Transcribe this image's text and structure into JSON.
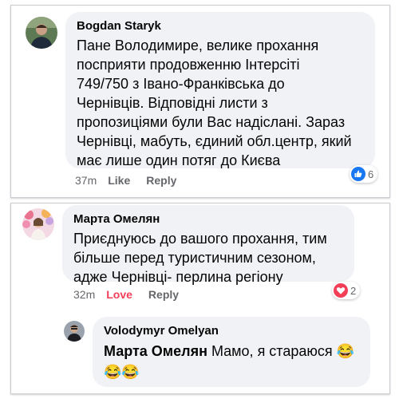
{
  "comments": [
    {
      "author": "Bogdan Staryk",
      "lines": [
        "Пане Володимире, велике прохання",
        "посприяти продовженню Інтерсіті",
        "749/750 з Івано-Франківська до",
        "Чернівців. Відповідні листи з",
        "пропозиціями були Вас надіслані. Зараз",
        "Чернівці, мабуть, єдиний обл.центр, який",
        "має лише один потяг до Києва"
      ],
      "time": "37m",
      "like_label": "Like",
      "reply_label": "Reply",
      "reaction": {
        "icon": "like-reaction-icon",
        "count": "6"
      }
    },
    {
      "author": "Марта Омелян",
      "lines": [
        "Приєднуюсь до вашого прохання, тим",
        "більше перед туристичним сезоном,",
        "адже  Чернівці- перлина регіону"
      ],
      "time": "32m",
      "like_label": "Love",
      "reply_label": "Reply",
      "reaction": {
        "icon": "love-reaction-icon",
        "count": "2"
      }
    },
    {
      "author": "Volodymyr Omelyan",
      "mention": "Марта Омелян",
      "text": "Мамо, я стараюся",
      "emoji_inline": "😂",
      "emoji_line2": "😂😂"
    }
  ],
  "colors": {
    "bubble": "#f0f2f5",
    "meta": "#65676b",
    "love": "#f33e58",
    "like_blue": "#1877f2"
  }
}
